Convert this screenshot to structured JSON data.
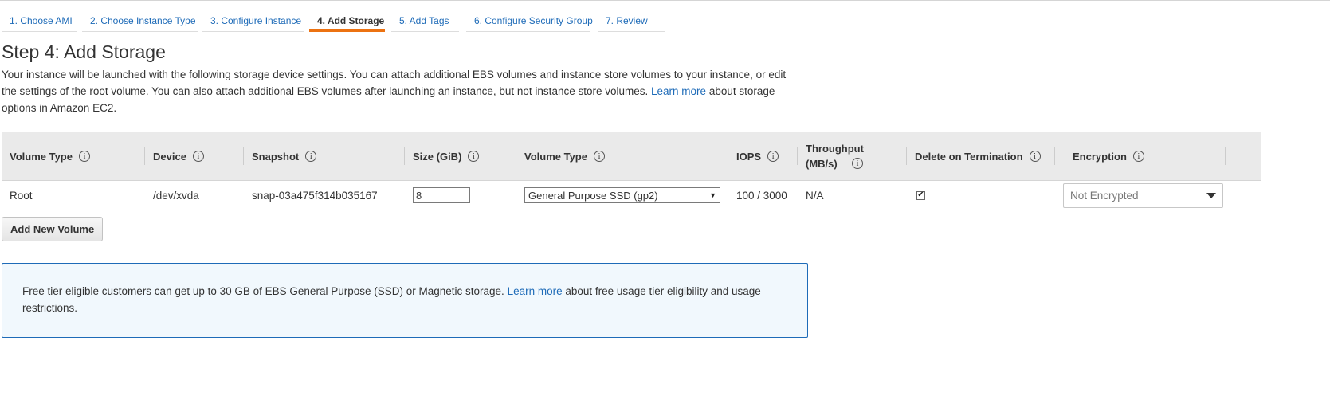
{
  "wizard": {
    "steps": [
      {
        "label": "1. Choose AMI"
      },
      {
        "label": "2. Choose Instance Type"
      },
      {
        "label": "3. Configure Instance"
      },
      {
        "label": "4. Add Storage"
      },
      {
        "label": "5. Add Tags"
      },
      {
        "label": "6. Configure Security Group"
      },
      {
        "label": "7. Review"
      }
    ],
    "active_step": "4. Add Storage"
  },
  "page": {
    "title": "Step 4: Add Storage",
    "description_1": "Your instance will be launched with the following storage device settings. You can attach additional EBS volumes and instance store volumes to your instance, or edit the settings of the root volume. You can also attach additional EBS volumes after launching an instance, but not instance store volumes.",
    "learn_more": "Learn more",
    "description_2": "about storage options in Amazon EC2."
  },
  "table": {
    "headers": {
      "volume_type": "Volume Type",
      "device": "Device",
      "snapshot": "Snapshot",
      "size": "Size (GiB)",
      "volume_type_2": "Volume Type",
      "iops": "IOPS",
      "throughput": "Throughput (MB/s)",
      "delete_on_termination": "Delete on Termination",
      "encryption": "Encryption"
    },
    "info_glyph": "i",
    "row": {
      "volume_type": "Root",
      "device": "/dev/xvda",
      "snapshot": "snap-03a475f314b035167",
      "size": "8",
      "ebs_volume_type": "General Purpose SSD (gp2)",
      "iops": "100 / 3000",
      "throughput": "N/A",
      "delete_on_termination": true,
      "checkmark": "✔",
      "encryption": "Not Encrypted"
    }
  },
  "add_volume_label": "Add New Volume",
  "notice": {
    "text_1": "Free tier eligible customers can get up to 30 GB of EBS General Purpose (SSD) or Magnetic storage.",
    "learn_more": "Learn more",
    "text_2": "about free usage tier eligibility and usage restrictions."
  },
  "colors": {
    "link": "#1e6bb8",
    "active_tab_underline": "#ec7211",
    "header_bg": "#eaeaea",
    "notice_bg": "#f1f8fd",
    "notice_border": "#1e6bb8"
  },
  "icons": [
    "info-icon",
    "dropdown-arrow-icon",
    "caret-down-icon",
    "checkbox-checked"
  ]
}
